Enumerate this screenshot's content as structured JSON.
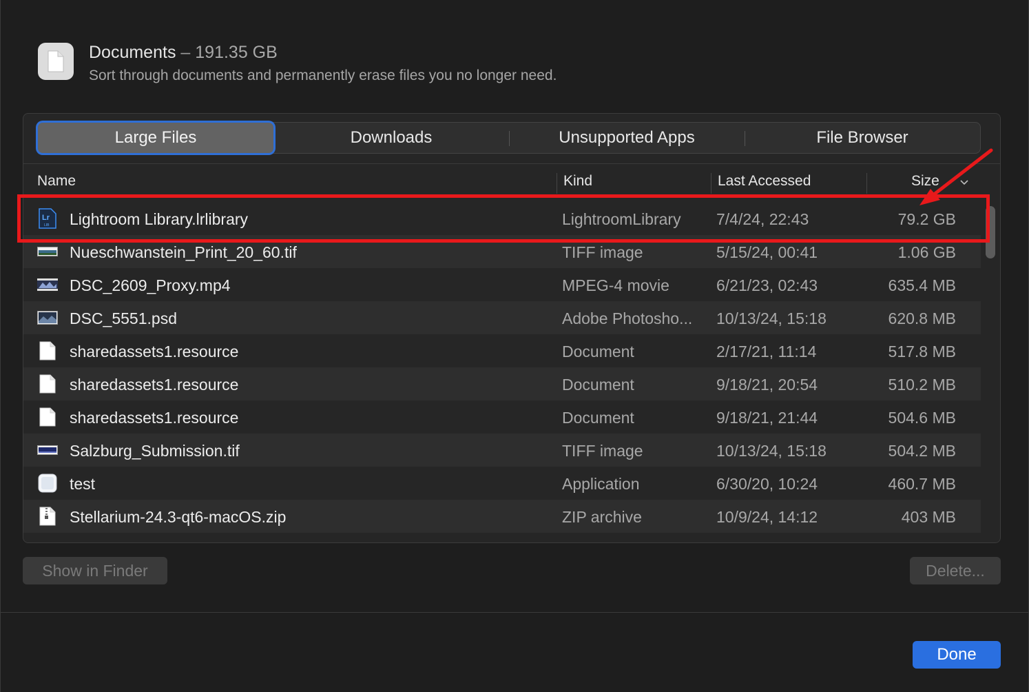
{
  "header": {
    "title": "Documents",
    "separator": "–",
    "size": "191.35 GB",
    "subtitle": "Sort through documents and permanently erase files you no longer need."
  },
  "tabs": [
    {
      "label": "Large Files",
      "active": true
    },
    {
      "label": "Downloads",
      "active": false
    },
    {
      "label": "Unsupported Apps",
      "active": false
    },
    {
      "label": "File Browser",
      "active": false
    }
  ],
  "columns": {
    "name": "Name",
    "kind": "Kind",
    "last_accessed": "Last Accessed",
    "size": "Size"
  },
  "rows": [
    {
      "icon": "lightroom-icon",
      "name": "Lightroom Library.lrlibrary",
      "kind": "LightroomLibrary",
      "date": "7/4/24, 22:43",
      "size": "79.2 GB"
    },
    {
      "icon": "image-thumbnail-icon",
      "name": "Nueschwanstein_Print_20_60.tif",
      "kind": "TIFF image",
      "date": "5/15/24, 00:41",
      "size": "1.06 GB"
    },
    {
      "icon": "video-thumbnail-icon",
      "name": "DSC_2609_Proxy.mp4",
      "kind": "MPEG-4 movie",
      "date": "6/21/23, 02:43",
      "size": "635.4 MB"
    },
    {
      "icon": "image-thumbnail-icon",
      "name": "DSC_5551.psd",
      "kind": "Adobe Photosho...",
      "date": "10/13/24, 15:18",
      "size": "620.8 MB"
    },
    {
      "icon": "document-icon",
      "name": "sharedassets1.resource",
      "kind": "Document",
      "date": "2/17/21, 11:14",
      "size": "517.8 MB"
    },
    {
      "icon": "document-icon",
      "name": "sharedassets1.resource",
      "kind": "Document",
      "date": "9/18/21, 20:54",
      "size": "510.2 MB"
    },
    {
      "icon": "document-icon",
      "name": "sharedassets1.resource",
      "kind": "Document",
      "date": "9/18/21, 21:44",
      "size": "504.6 MB"
    },
    {
      "icon": "image-thumbnail-icon",
      "name": "Salzburg_Submission.tif",
      "kind": "TIFF image",
      "date": "10/13/24, 15:18",
      "size": "504.2 MB"
    },
    {
      "icon": "application-icon",
      "name": "test",
      "kind": "Application",
      "date": "6/30/20, 10:24",
      "size": "460.7 MB"
    },
    {
      "icon": "zip-archive-icon",
      "name": "Stellarium-24.3-qt6-macOS.zip",
      "kind": "ZIP archive",
      "date": "10/9/24, 14:12",
      "size": "403 MB"
    }
  ],
  "buttons": {
    "show_in_finder": "Show in Finder",
    "delete": "Delete...",
    "done": "Done"
  },
  "colors": {
    "accent": "#2a6fe0",
    "annotation": "#e8191b",
    "background": "#1e1e1e"
  }
}
